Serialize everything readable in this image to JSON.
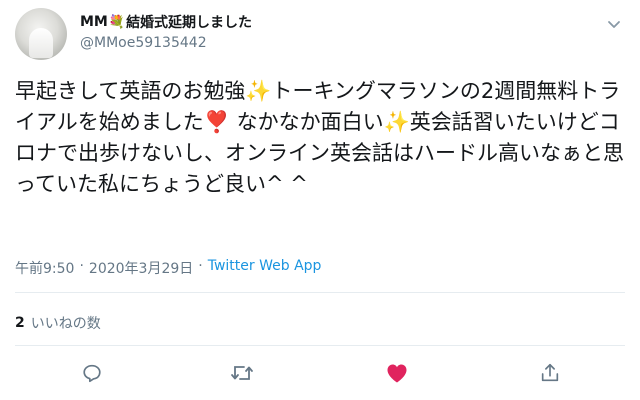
{
  "tweet": {
    "display_name": "MM",
    "display_name_suffix": "結婚式延期しました",
    "handle": "@MMoe59135442",
    "text": "早起きして英語のお勉強✨トーキングマラソンの2週間無料トライアルを始めました❣️ なかなか面白い✨英会話習いたいけどコロナで出歩けないし、オンライン英会話はハードル高いなぁと思っていた私にちょうど良い^ ^",
    "time": "午前9:50",
    "separator": "·",
    "date": "2020年3月29日",
    "source": "Twitter Web App",
    "like_count": "2",
    "like_label": "いいねの数"
  },
  "actions": {
    "reply_icon": "reply-icon",
    "retweet_icon": "retweet-icon",
    "like_icon": "heart-icon",
    "share_icon": "share-icon",
    "like_color": "#e0245e"
  },
  "colors": {
    "text": "#14171a",
    "secondary": "#657786",
    "link": "#1b95e0",
    "border": "#e6ecf0"
  }
}
